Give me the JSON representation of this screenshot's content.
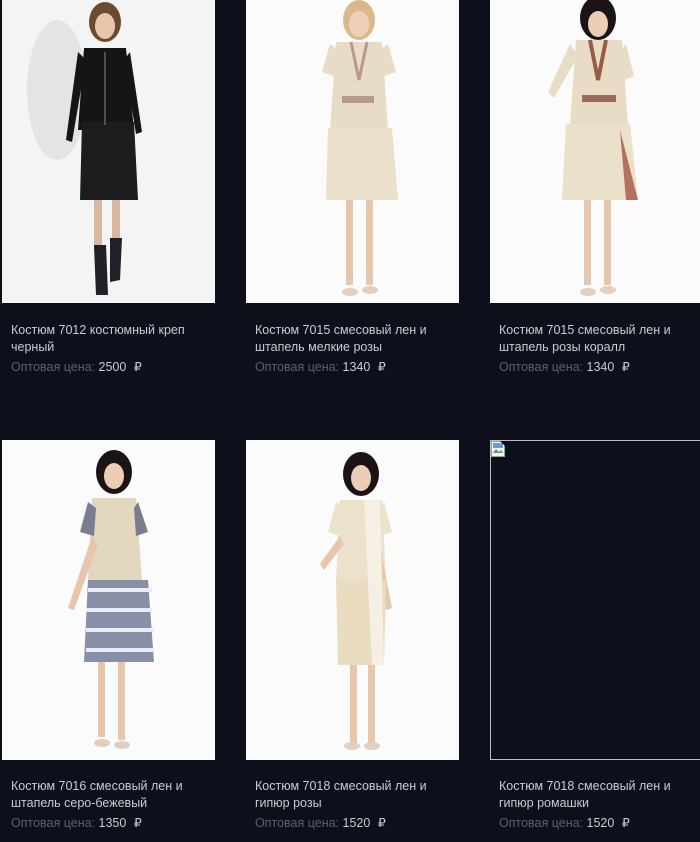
{
  "products": [
    {
      "title": "Костюм 7012 костюмный креп черный",
      "price_label": "Оптовая цена:",
      "price": "2500",
      "currency": "₽",
      "image": "woman-black-suit"
    },
    {
      "title": "Костюм 7015 смесовый лен и штапель мелкие розы",
      "price_label": "Оптовая цена:",
      "price": "1340",
      "currency": "₽",
      "image": "woman-beige-suit-floral-trim"
    },
    {
      "title": "Костюм 7015 смесовый лен и штапель розы коралл",
      "price_label": "Оптовая цена:",
      "price": "1340",
      "currency": "₽",
      "image": "woman-beige-suit-coral-roses"
    },
    {
      "title": "Костюм 7016 смесовый лен и штапель серо-бежевый",
      "price_label": "Оптовая цена:",
      "price": "1350",
      "currency": "₽",
      "image": "woman-beige-top-printed-skirt"
    },
    {
      "title": "Костюм 7018 смесовый лен и гипюр розы",
      "price_label": "Оптовая цена:",
      "price": "1520",
      "currency": "₽",
      "image": "woman-beige-dress-lace"
    },
    {
      "title": "Костюм 7018 смесовый лен и гипюр ромашки",
      "price_label": "Оптовая цена:",
      "price": "1520",
      "currency": "₽",
      "image": "broken-image-icon"
    }
  ],
  "colors": {
    "background": "#0c101a",
    "text": "#c9ccd1",
    "label": "#5c6069"
  }
}
